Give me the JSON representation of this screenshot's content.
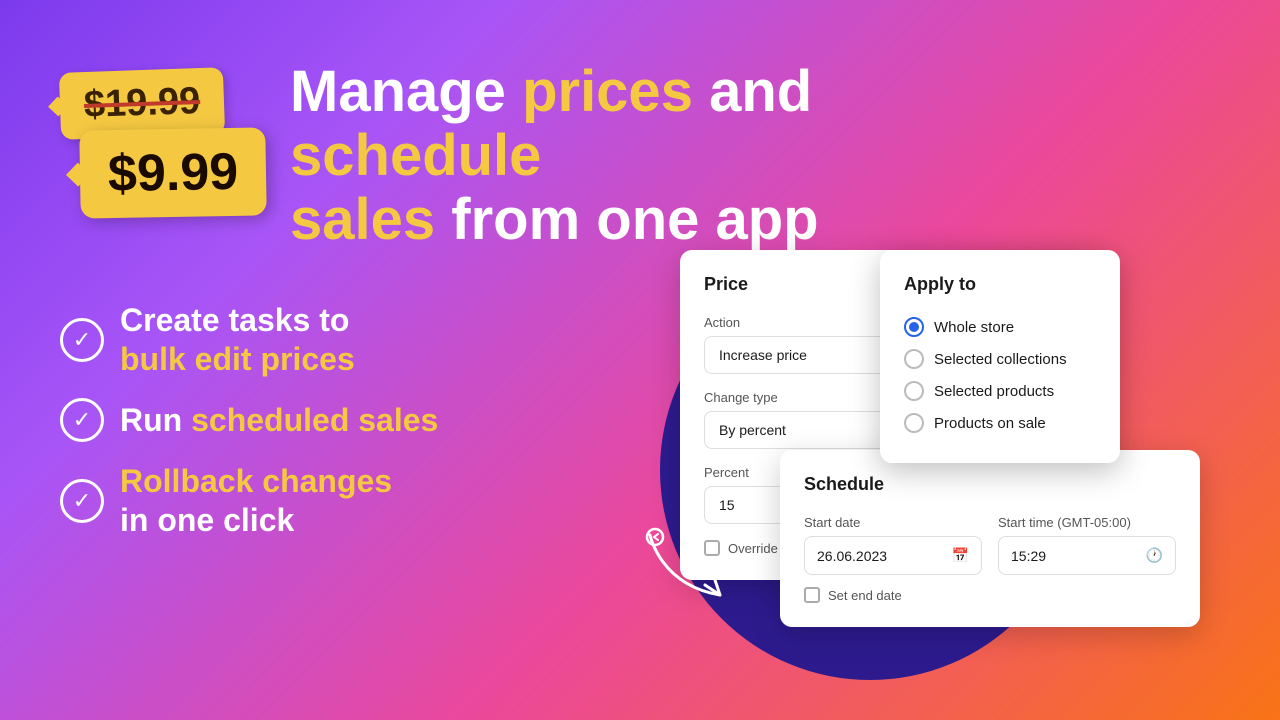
{
  "background": {
    "gradient_start": "#7c3aed",
    "gradient_end": "#f97316"
  },
  "price_tags": {
    "old_price": "$19.99",
    "new_price": "$9.99"
  },
  "main_title": {
    "part1": "Manage ",
    "highlight1": "prices",
    "part2": " and ",
    "highlight2": "schedule",
    "part3": "sales",
    "part4": " from one app"
  },
  "features": [
    {
      "text_plain": "Create tasks to ",
      "text_highlight": "bulk edit prices",
      "text_after": ""
    },
    {
      "text_plain": "Run ",
      "text_highlight": "scheduled sales",
      "text_after": ""
    },
    {
      "text_plain": "Rollback changes\nin one click",
      "text_highlight": "",
      "text_after": ""
    }
  ],
  "price_card": {
    "title": "Price",
    "action_label": "Action",
    "action_value": "Increase price",
    "change_type_label": "Change type",
    "change_type_value": "By percent",
    "percent_label": "Percent",
    "percent_value": "15",
    "override_label": "Override cents"
  },
  "apply_to_card": {
    "title": "Apply to",
    "options": [
      {
        "label": "Whole store",
        "selected": true
      },
      {
        "label": "Selected collections",
        "selected": false
      },
      {
        "label": "Selected products",
        "selected": false
      },
      {
        "label": "Products on sale",
        "selected": false
      }
    ]
  },
  "schedule_card": {
    "title": "Schedule",
    "start_date_label": "Start date",
    "start_date_value": "26.06.2023",
    "start_time_label": "Start time (GMT-05:00)",
    "start_time_value": "15:29",
    "set_end_date_label": "Set end date"
  }
}
